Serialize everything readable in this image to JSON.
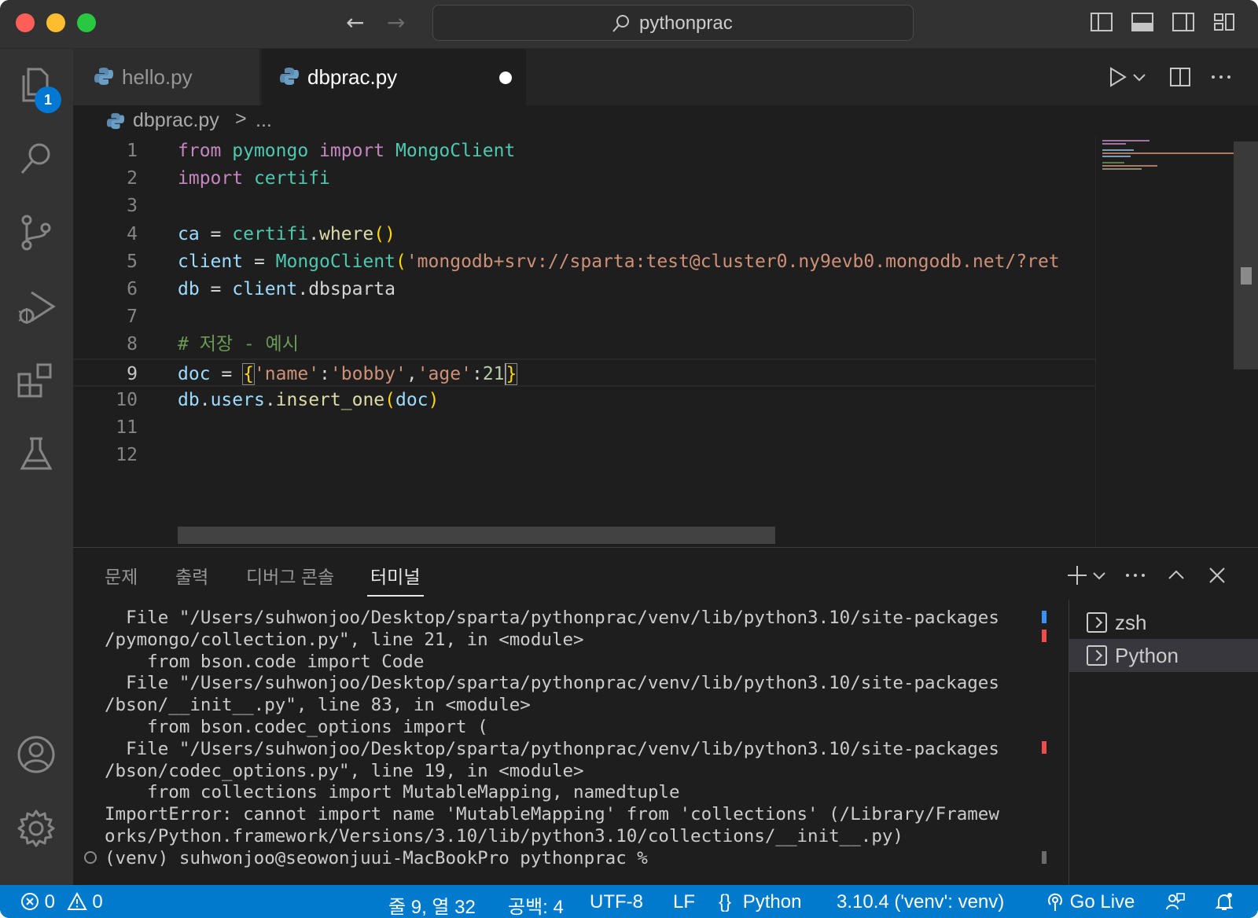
{
  "titlebar": {
    "search_text": "pythonprac"
  },
  "activity_bar": {
    "explorer_badge": "1"
  },
  "tabs": [
    {
      "label": "hello.py"
    },
    {
      "label": "dbprac.py"
    }
  ],
  "breadcrumb": {
    "file": "dbprac.py",
    "separator": ">",
    "more": "..."
  },
  "editor": {
    "line_numbers": [
      "1",
      "2",
      "3",
      "4",
      "5",
      "6",
      "7",
      "8",
      "9",
      "10",
      "11",
      "12"
    ],
    "lines": [
      [
        {
          "t": "from",
          "c": "kw"
        },
        {
          "t": " "
        },
        {
          "t": "pymongo",
          "c": "mod"
        },
        {
          "t": " "
        },
        {
          "t": "import",
          "c": "kw"
        },
        {
          "t": " "
        },
        {
          "t": "MongoClient",
          "c": "mod"
        }
      ],
      [
        {
          "t": "import",
          "c": "kw"
        },
        {
          "t": " "
        },
        {
          "t": "certifi",
          "c": "mod"
        }
      ],
      [],
      [
        {
          "t": "ca",
          "c": "var"
        },
        {
          "t": " = "
        },
        {
          "t": "certifi",
          "c": "mod"
        },
        {
          "t": "."
        },
        {
          "t": "where",
          "c": "fn"
        },
        {
          "t": "()",
          "c": "par"
        }
      ],
      [
        {
          "t": "client",
          "c": "var"
        },
        {
          "t": " = "
        },
        {
          "t": "MongoClient",
          "c": "mod"
        },
        {
          "t": "(",
          "c": "par"
        },
        {
          "t": "'mongodb+srv://sparta:test@cluster0.ny9evb0.mongodb.net/?ret",
          "c": "str"
        }
      ],
      [
        {
          "t": "db",
          "c": "var"
        },
        {
          "t": " = "
        },
        {
          "t": "client",
          "c": "var"
        },
        {
          "t": "."
        },
        {
          "t": "dbsparta"
        }
      ],
      [],
      [
        {
          "t": "# 저장 - 예시",
          "c": "cmt"
        }
      ],
      [
        {
          "t": "doc",
          "c": "var"
        },
        {
          "t": " = "
        },
        {
          "t": "{",
          "c": "par box"
        },
        {
          "t": "'name'",
          "c": "str"
        },
        {
          "t": ":"
        },
        {
          "t": "'bobby'",
          "c": "str"
        },
        {
          "t": ","
        },
        {
          "t": "'age'",
          "c": "str"
        },
        {
          "t": ":"
        },
        {
          "t": "21",
          "c": "num"
        },
        {
          "t": "CURSOR"
        },
        {
          "t": "}",
          "c": "par box"
        }
      ],
      [
        {
          "t": "db",
          "c": "var"
        },
        {
          "t": "."
        },
        {
          "t": "users",
          "c": "var"
        },
        {
          "t": "."
        },
        {
          "t": "insert_one",
          "c": "fn"
        },
        {
          "t": "(",
          "c": "par"
        },
        {
          "t": "doc",
          "c": "var"
        },
        {
          "t": ")",
          "c": "par"
        }
      ],
      [],
      []
    ]
  },
  "panel": {
    "tabs": [
      "문제",
      "출력",
      "디버그 콘솔",
      "터미널"
    ],
    "active_tab": "터미널",
    "terminal_lines": [
      "  File \"/Users/suhwonjoo/Desktop/sparta/pythonprac/venv/lib/python3.10/site-packages",
      "/pymongo/collection.py\", line 21, in <module>",
      "    from bson.code import Code",
      "  File \"/Users/suhwonjoo/Desktop/sparta/pythonprac/venv/lib/python3.10/site-packages",
      "/bson/__init__.py\", line 83, in <module>",
      "    from bson.codec_options import (",
      "  File \"/Users/suhwonjoo/Desktop/sparta/pythonprac/venv/lib/python3.10/site-packages",
      "/bson/codec_options.py\", line 19, in <module>",
      "    from collections import MutableMapping, namedtuple",
      "ImportError: cannot import name 'MutableMapping' from 'collections' (/Library/Framew",
      "orks/Python.framework/Versions/3.10/lib/python3.10/collections/__init__.py)",
      "(venv) suhwonjoo@seowonjuui-MacBookPro pythonprac %"
    ],
    "terminals": [
      {
        "label": "zsh"
      },
      {
        "label": "Python"
      }
    ]
  },
  "statusbar": {
    "errors": "0",
    "warnings": "0",
    "cursor_pos": "줄 9, 열 32",
    "indent": "공백: 4",
    "encoding": "UTF-8",
    "eol": "LF",
    "language": "Python",
    "interpreter": "3.10.4 ('venv': venv)",
    "go_live": "Go Live"
  },
  "colors": {
    "statusbar": "#007acc",
    "accent_badge": "#0078d4",
    "editor_bg": "#1e1e1e"
  }
}
